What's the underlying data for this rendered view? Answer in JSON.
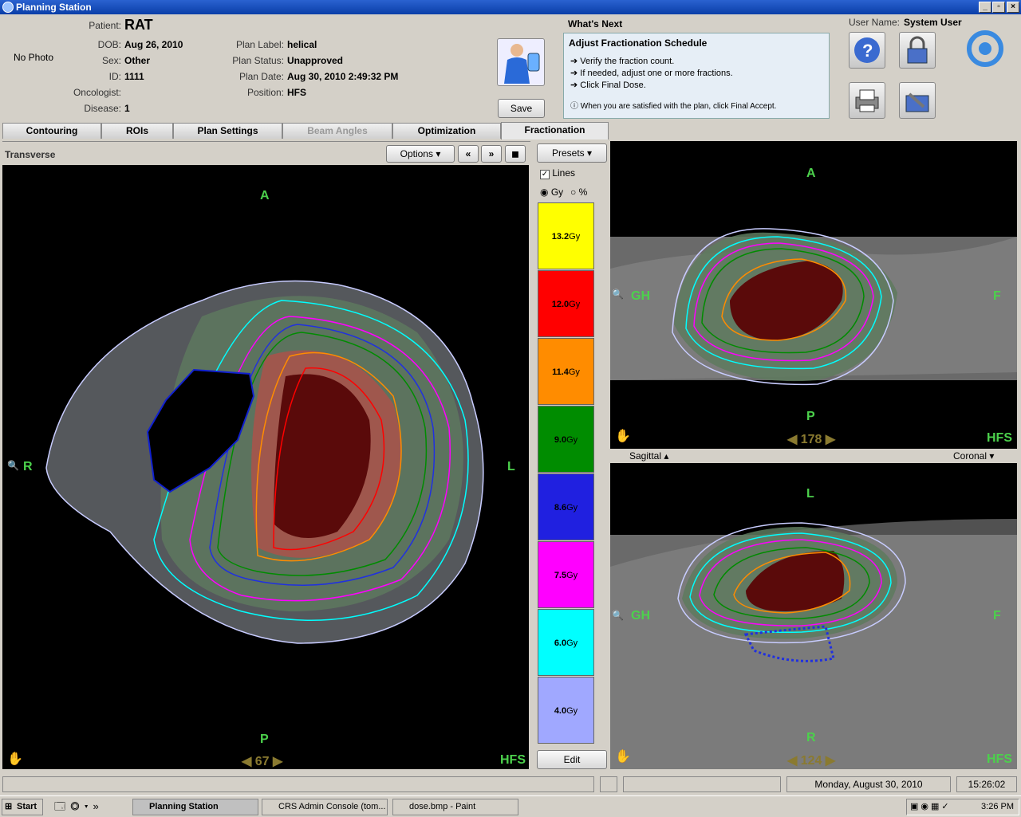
{
  "window": {
    "title": "Planning Station"
  },
  "patient": {
    "no_photo": "No Photo",
    "labels": {
      "patient": "Patient:",
      "dob": "DOB:",
      "sex": "Sex:",
      "id": "ID:",
      "oncologist": "Oncologist:",
      "disease": "Disease:"
    },
    "name": "RAT",
    "dob": "Aug 26, 2010",
    "sex": "Other",
    "id": "1111",
    "oncologist": "",
    "disease": "1"
  },
  "plan": {
    "labels": {
      "label": "Plan Label:",
      "status": "Plan Status:",
      "date": "Plan Date:",
      "position": "Position:"
    },
    "label": "helical",
    "status": "Unapproved",
    "date": "Aug 30, 2010 2:49:32 PM",
    "position": "HFS"
  },
  "save_label": "Save",
  "whats_next": {
    "heading": "What's Next",
    "title": "Adjust Fractionation Schedule",
    "steps": [
      "Verify the fraction count.",
      "If needed, adjust one or more fractions.",
      "Click Final Dose."
    ],
    "note": "When you are satisfied with the plan, click Final Accept."
  },
  "user": {
    "label": "User Name:",
    "name": "System User"
  },
  "tabs": [
    "Contouring",
    "ROIs",
    "Plan Settings",
    "Beam Angles",
    "Optimization",
    "Fractionation"
  ],
  "transverse": {
    "title": "Transverse",
    "options": "Options",
    "top": "A",
    "left": "R",
    "right": "L",
    "bottom": "P",
    "slice": "67",
    "orient": "HFS"
  },
  "legend": {
    "presets": "Presets",
    "lines": "Lines",
    "gy": "Gy",
    "pct": "%",
    "edit": "Edit",
    "levels": [
      {
        "value": "13.2",
        "unit": "Gy",
        "color": "#ffff00"
      },
      {
        "value": "12.0",
        "unit": "Gy",
        "color": "#ff0000"
      },
      {
        "value": "11.4",
        "unit": "Gy",
        "color": "#ff8c00"
      },
      {
        "value": "9.0",
        "unit": "Gy",
        "color": "#008c00"
      },
      {
        "value": "8.6",
        "unit": "Gy",
        "color": "#2020e0"
      },
      {
        "value": "7.5",
        "unit": "Gy",
        "color": "#ff00ff"
      },
      {
        "value": "6.0",
        "unit": "Gy",
        "color": "#00ffff"
      },
      {
        "value": "4.0",
        "unit": "Gy",
        "color": "#a0a8ff"
      }
    ]
  },
  "top_view": {
    "top": "A",
    "left": "GH",
    "right": "F",
    "bottom": "P",
    "slice": "178",
    "orient": "HFS"
  },
  "splitter": {
    "left": "Sagittal",
    "right": "Coronal"
  },
  "bottom_view": {
    "top": "L",
    "left": "GH",
    "right": "F",
    "bottom": "R",
    "slice": "124",
    "orient": "HFS"
  },
  "status": {
    "date": "Monday, August 30, 2010",
    "time": "15:26:02"
  },
  "taskbar": {
    "start": "Start",
    "tasks": [
      "Planning Station",
      "CRS Admin Console (tom...",
      "dose.bmp - Paint"
    ],
    "clock": "3:26 PM"
  }
}
